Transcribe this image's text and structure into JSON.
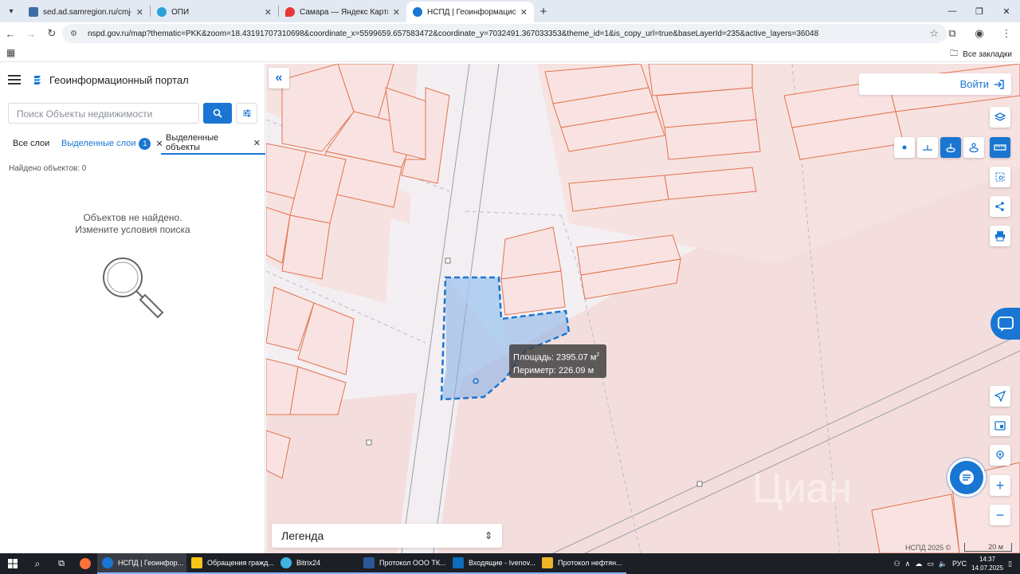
{
  "browser": {
    "tabs": [
      {
        "title": "sed.ad.samregion.ru/cmj-web/",
        "color": "#3b6ea5"
      },
      {
        "title": "ОПИ",
        "color": "#2aa1d9"
      },
      {
        "title": "Самара — Яндекс Карты",
        "color": "#e53935"
      },
      {
        "title": "НСПД | Геоинформационный",
        "color": "#1976d2"
      }
    ],
    "url": "nspd.gov.ru/map?thematic=PKK&zoom=18.43191707310698&coordinate_x=5599659.657583472&coordinate_y=7032491.367033353&theme_id=1&is_copy_url=true&baseLayerId=235&active_layers=36048",
    "bookmarks_all": "Все закладки"
  },
  "sidebar": {
    "title": "Геоинформационный портал",
    "search_placeholder": "Поиск Объекты недвижимости",
    "tabs": {
      "all_layers": "Все слои",
      "selected_layers": "Выделенные слои",
      "selected_layers_count": "1",
      "selected_objects": "Выделенные объекты"
    },
    "found": "Найдено объектов: 0",
    "empty_line1": "Объектов не найдено.",
    "empty_line2": "Измените условия поиска"
  },
  "map": {
    "login": "Войти",
    "area_label": "Площадь: 2395.07 м",
    "area_sup": "2",
    "perimeter_label": "Периметр: 226.09 м",
    "legend": "Легенда",
    "copyright": "НСПД 2025 ©",
    "scale": "20 м",
    "watermark": "Циан",
    "colors": {
      "parcel_line": "#e2734f",
      "selection": "#1976d2",
      "fill": "#f4dedd"
    }
  },
  "taskbar": {
    "apps": [
      {
        "label": "НСПД | Геоинфор...",
        "color": "#1976d2"
      },
      {
        "label": "Обращения гражд...",
        "color": "#f5c518"
      },
      {
        "label": "Bitrix24",
        "color": "#3fb4e0"
      },
      {
        "label": "Протокол ООО ТК...",
        "color": "#2b5797"
      },
      {
        "label": "Входящие - Ivenov...",
        "color": "#0f6cbd"
      },
      {
        "label": "Протокол нефтян...",
        "color": "#f0b429"
      }
    ],
    "lang": "РУС",
    "time": "14:37",
    "date": "14.07.2025"
  }
}
